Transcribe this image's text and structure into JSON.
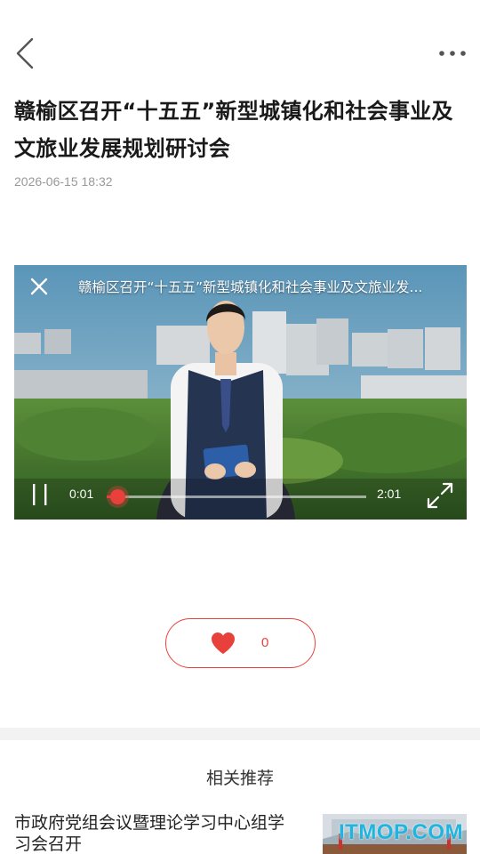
{
  "header": {
    "back_icon": "chevron-left-icon",
    "more_icon": "more-horizontal-icon"
  },
  "article": {
    "title": "赣榆区召开“十五五”新型城镇化和社会事业及文旅业发展规划研讨会",
    "published_time": "2026-06-15 18:32"
  },
  "video": {
    "title": "赣榆区召开“十五五”新型城镇化和社会事业及文旅业发...",
    "current_time": "0:01",
    "total_time": "2:01",
    "progress": 0.04,
    "close_icon": "close-icon",
    "pause_icon": "pause-icon",
    "fullscreen_icon": "fullscreen-icon"
  },
  "like": {
    "count": "0",
    "icon": "heart-icon",
    "color": "#e8413b"
  },
  "related": {
    "section_title": "相关推荐",
    "items": [
      {
        "title": "市政府党组会议暨理论学习中心组学习会召开"
      }
    ]
  },
  "watermark": {
    "text": "ITMOP.COM"
  },
  "colors": {
    "accent": "#e8413b",
    "watermark": "#1fb5e0"
  }
}
